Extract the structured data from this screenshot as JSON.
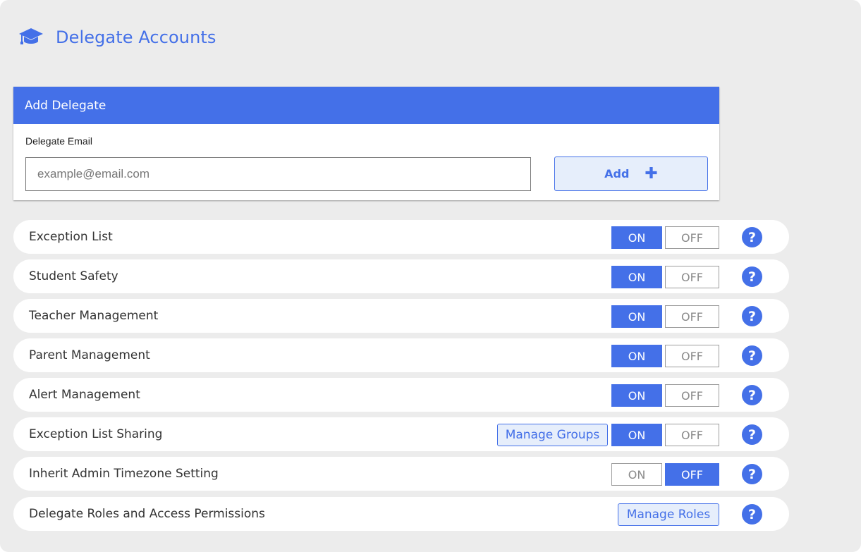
{
  "header": {
    "icon": "graduation-cap-icon",
    "title": "Delegate Accounts"
  },
  "add_delegate": {
    "title": "Add Delegate",
    "email_label": "Delegate Email",
    "email_value": "",
    "email_placeholder": "example@email.com",
    "add_label": "Add",
    "add_icon": "plus-icon"
  },
  "settings": [
    {
      "label": "Exception List",
      "on_label": "ON",
      "off_label": "OFF",
      "state": "on"
    },
    {
      "label": "Student Safety",
      "on_label": "ON",
      "off_label": "OFF",
      "state": "on"
    },
    {
      "label": "Teacher Management",
      "on_label": "ON",
      "off_label": "OFF",
      "state": "on"
    },
    {
      "label": "Parent Management",
      "on_label": "ON",
      "off_label": "OFF",
      "state": "on"
    },
    {
      "label": "Alert Management",
      "on_label": "ON",
      "off_label": "OFF",
      "state": "on"
    },
    {
      "label": "Exception List Sharing",
      "manage_label": "Manage Groups",
      "on_label": "ON",
      "off_label": "OFF",
      "state": "on"
    },
    {
      "label": "Inherit Admin Timezone Setting",
      "on_label": "ON",
      "off_label": "OFF",
      "state": "off"
    },
    {
      "label": "Delegate Roles and Access Permissions",
      "manage_label": "Manage Roles"
    }
  ],
  "help_symbol": "?",
  "colors": {
    "accent": "#4470e8",
    "accent_light": "#e6eefb",
    "background": "#ececec"
  }
}
